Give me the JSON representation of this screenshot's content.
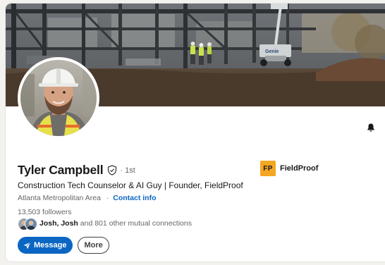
{
  "profile": {
    "name": "Tyler Campbell",
    "degree": "· 1st",
    "headline": "Construction Tech Counselor & AI Guy | Founder, FieldProof",
    "location": "Atlanta Metropolitan Area",
    "location_separator": "·",
    "contact_info_label": "Contact info",
    "followers": "13,503 followers",
    "mutual": {
      "names": "Josh, Josh",
      "rest": " and 801 other mutual connections"
    }
  },
  "company": {
    "logo_text": "FP",
    "name": "FieldProof"
  },
  "banner": {
    "sign_text": "Genie"
  },
  "actions": {
    "message_label": "Message",
    "more_label": "More"
  },
  "icons": {
    "bell": "bell-icon",
    "verified": "verified-shield-icon",
    "send": "paper-plane-icon"
  },
  "colors": {
    "accent": "#0a66c2",
    "company_logo": "#f5a623",
    "text_primary": "#191919",
    "text_secondary": "#666666"
  }
}
